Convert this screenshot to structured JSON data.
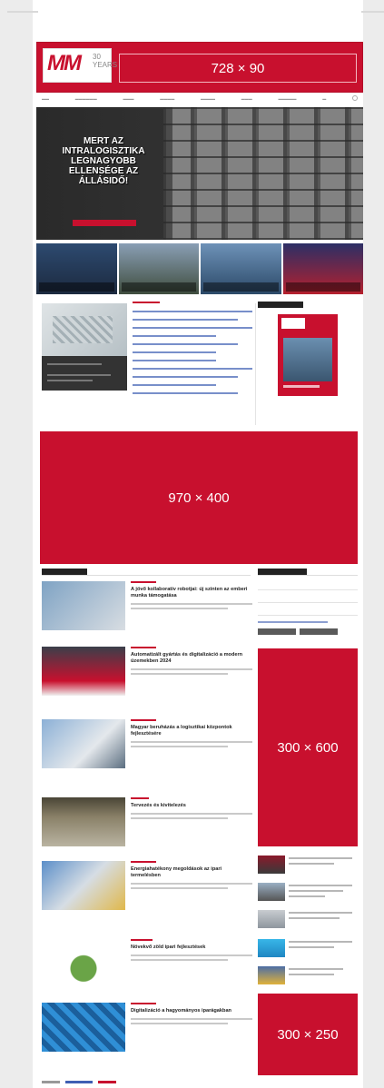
{
  "ads": {
    "top": "728 × 90",
    "billboard": "970 × 400",
    "half_page": "300 × 600",
    "rectangle": "300 × 250"
  },
  "logo": {
    "text": "MM",
    "years": "30 YEARS"
  },
  "hero": {
    "headline": "MERT AZ INTRALOGISZTIKA LEGNAGYOBB ELLENSÉGE AZ ÁLLÁSIDŐ!"
  },
  "articles": [
    {
      "title": "A jövő kollaboratív robotjai: új szinten az emberi munka támogatása"
    },
    {
      "title": "Automatizált gyártás és digitalizáció a modern üzemekben 2024"
    },
    {
      "title": "Magyar beruházás a logisztikai központok fejlesztésére"
    },
    {
      "title": "Tervezés és kivitelezés"
    },
    {
      "title": "Energiahatékony megoldások az ipari termelésben"
    },
    {
      "title": "Növekvő zöld ipari fejlesztések"
    },
    {
      "title": "Digitalizáció a hagyományos iparágakban"
    }
  ],
  "colors": {
    "brand": "#c8102e",
    "dark": "#222222"
  }
}
